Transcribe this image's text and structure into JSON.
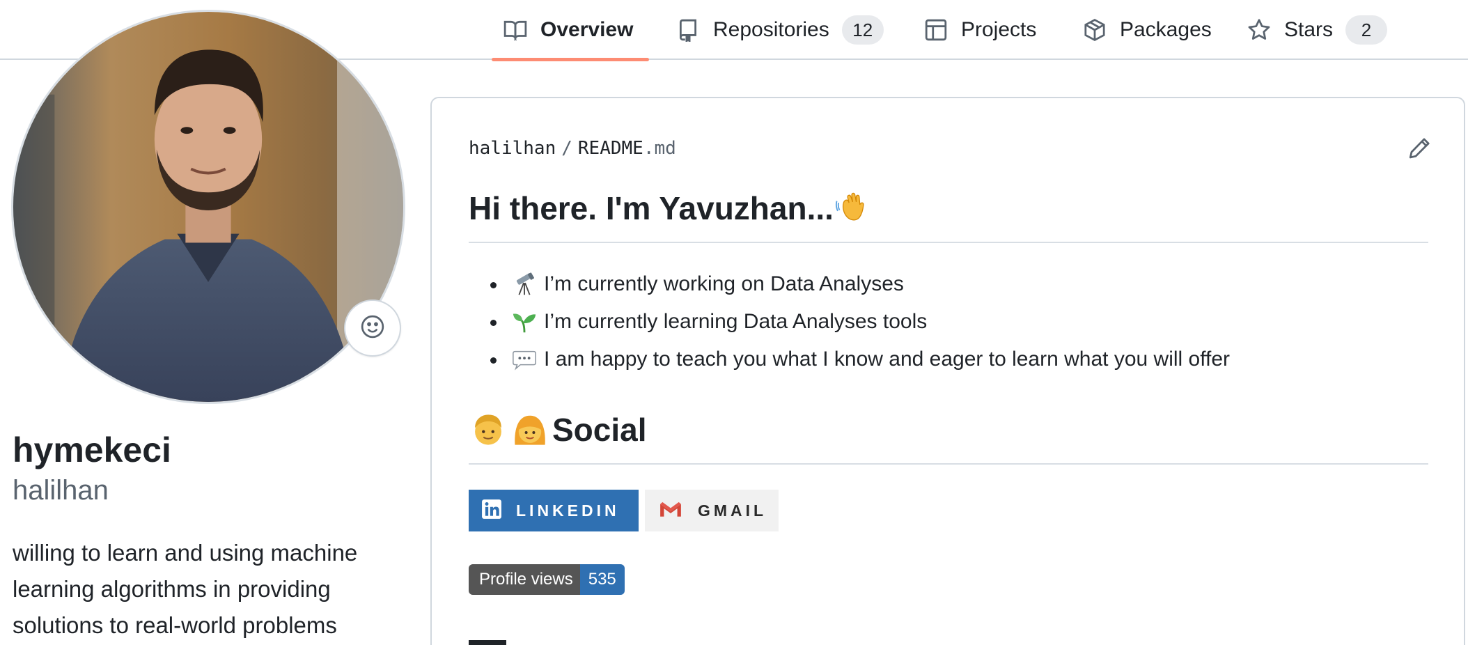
{
  "tabs": [
    {
      "label": "Overview",
      "icon": "book-icon",
      "selected": true
    },
    {
      "label": "Repositories",
      "icon": "repo-icon",
      "count": "12"
    },
    {
      "label": "Projects",
      "icon": "table-icon"
    },
    {
      "label": "Packages",
      "icon": "package-icon"
    },
    {
      "label": "Stars",
      "icon": "star-icon",
      "count": "2"
    }
  ],
  "profile": {
    "name": "hymekeci",
    "login": "halilhan",
    "bio": "willing to learn and using machine learning algorithms in providing solutions to real-world problems",
    "status_icon": "smiley-icon"
  },
  "readme": {
    "owner": "halilhan",
    "separator": "/",
    "file_base": "README",
    "file_ext": ".md",
    "edit_icon": "pencil-icon",
    "heading": "Hi there. I'm Yavuzhan...",
    "heading_icon": "waving-hand-icon",
    "items": [
      {
        "icon": "telescope-icon",
        "text": "I’m currently working on Data Analyses"
      },
      {
        "icon": "seedling-icon",
        "text": "I’m currently learning Data Analyses tools"
      },
      {
        "icon": "speech-bubble-icon",
        "text": "I am happy to teach you what I know and eager to learn what you will offer"
      }
    ],
    "social_heading": "Social",
    "social_icons": [
      "man-icon",
      "woman-icon"
    ],
    "badges": {
      "linkedin": "LINKEDIN",
      "gmail": "GMAIL"
    },
    "views": {
      "label": "Profile views",
      "count": "535"
    }
  },
  "colors": {
    "tab_underline": "#fd8c73",
    "linkedin_blue": "#2f70b2",
    "views_label_bg": "#555555",
    "border": "#d0d7de"
  }
}
